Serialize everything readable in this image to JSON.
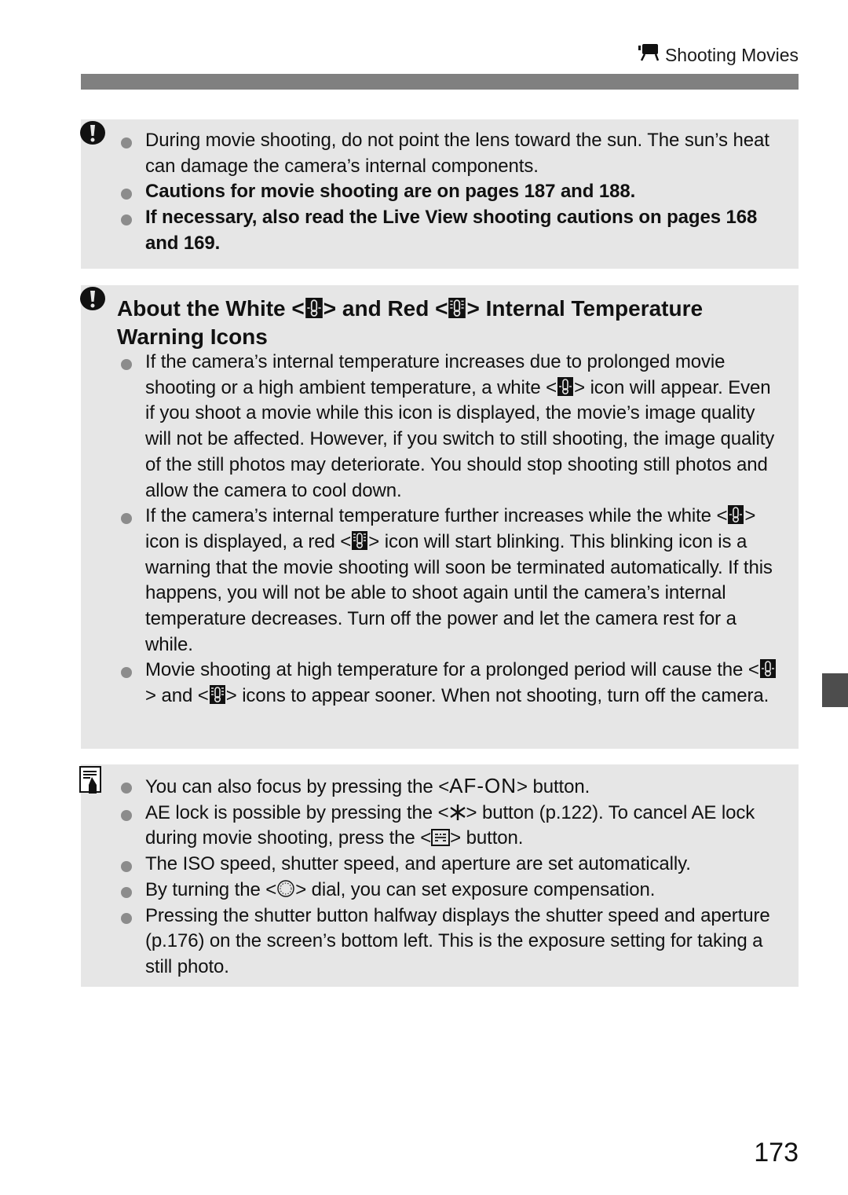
{
  "header": {
    "section_icon": "movie-camera-icon",
    "section_title": "Shooting Movies"
  },
  "caution_box": {
    "icon": "caution-icon",
    "items": [
      {
        "text": "During movie shooting, do not point the lens toward the sun. The sun’s heat can damage the camera’s internal components.",
        "bold": false
      },
      {
        "text": "Cautions for movie shooting are on pages 187 and 188.",
        "bold": true
      },
      {
        "text": "If necessary, also read the Live View shooting cautions on pages 168 and 169.",
        "bold": true
      }
    ]
  },
  "temperature_box": {
    "icon": "caution-icon",
    "title": {
      "part1": "About the White <",
      "part2": "> and Red <",
      "part3": "> Internal Temperature Warning Icons"
    },
    "white_icon": "white-temperature-warning-icon",
    "red_icon": "red-temperature-warning-icon",
    "items": [
      {
        "a": "If the camera’s internal temperature increases due to prolonged movie shooting or a high ambient temperature, a white <",
        "b": "> icon will appear. Even if you shoot a movie while this icon is displayed, the movie’s image quality will not be affected. However, if you switch to still shooting, the image quality of the still photos may deteriorate. You should stop shooting still photos and allow the camera to cool down."
      },
      {
        "a": "If the camera’s internal temperature further increases while the white <",
        "b": "> icon is displayed, a red <",
        "c": "> icon will start blinking. This blinking icon is a warning that the movie shooting will soon be terminated automatically. If this happens, you will not be able to shoot again until the camera’s internal temperature decreases. Turn off the power and let the camera rest for a while."
      },
      {
        "a": "Movie shooting at high temperature for a prolonged period will cause the <",
        "b": "> and <",
        "c": "> icons to appear sooner. When not shooting, turn off the camera."
      }
    ]
  },
  "note_box": {
    "icon": "memo-icon",
    "items": [
      {
        "a": "You can also focus by pressing the <",
        "symbol": "AF-ON",
        "b": "> button."
      },
      {
        "a": "AE lock is possible by pressing the <",
        "symbol_icon": "ae-lock-asterisk-icon",
        "b": "> button (p.122). To cancel AE lock during movie shooting, press the <",
        "symbol2_icon": "multi-function-button-icon",
        "c": "> button."
      },
      {
        "a": "The ISO speed, shutter speed, and aperture are set automatically."
      },
      {
        "a": "By turning the <",
        "symbol_icon": "quick-control-dial-icon",
        "b": "> dial, you can set exposure compensation."
      },
      {
        "a": "Pressing the shutter button halfway displays the shutter speed and aperture (p.176) on the screen’s bottom left. This is the exposure setting for taking a still photo."
      }
    ]
  },
  "page_number": "173"
}
